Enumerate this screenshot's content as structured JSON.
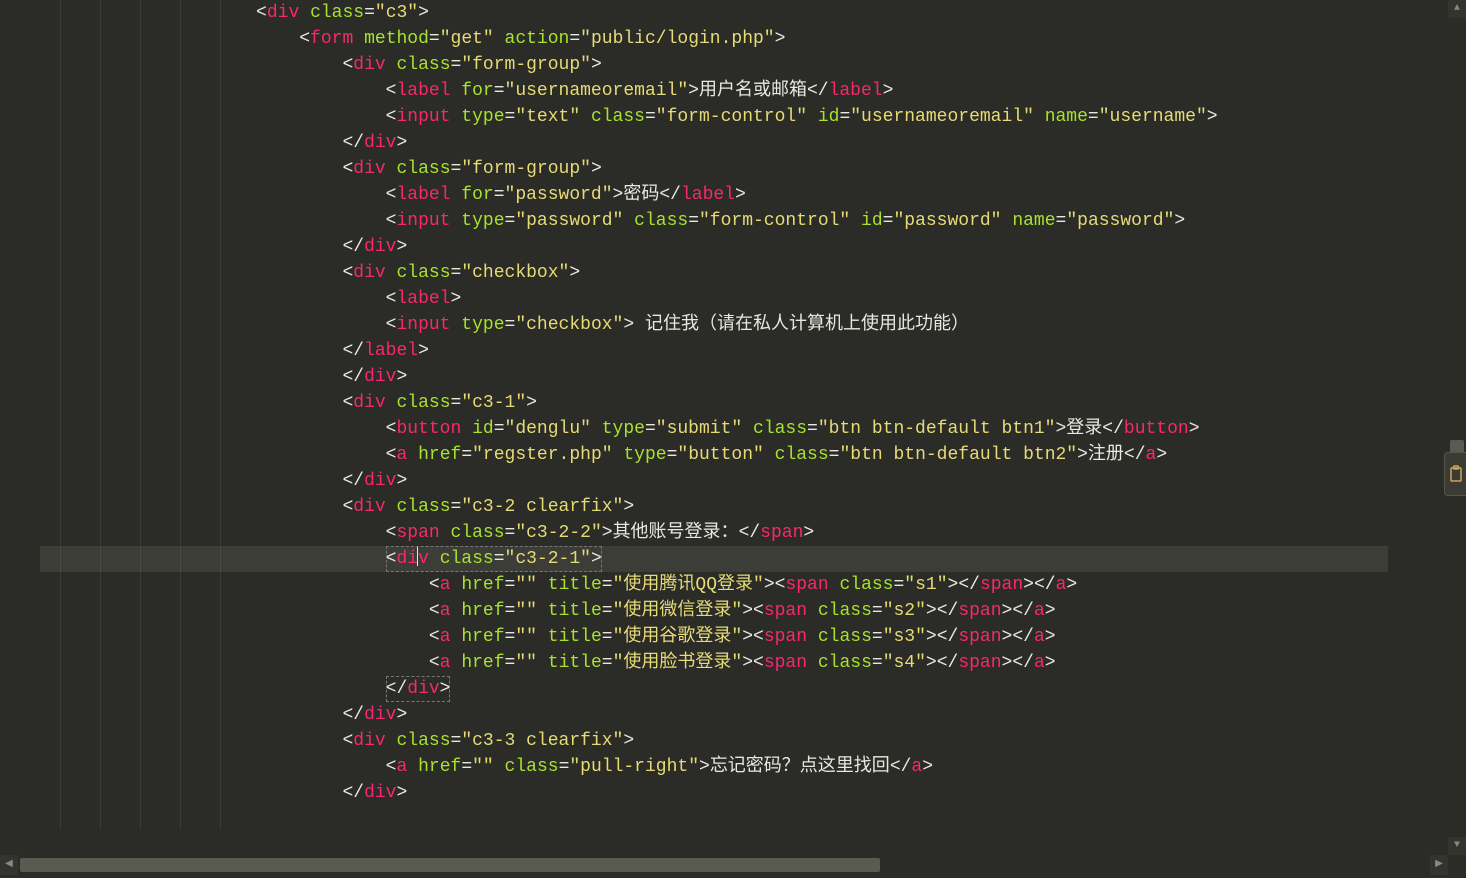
{
  "colors": {
    "bg": "#2b2b27",
    "tag": "#f92672",
    "attr": "#a6e22e",
    "string": "#e6db74",
    "text": "#e8e8e0"
  },
  "highlighted_line_index": 21,
  "lines": [
    {
      "indent": 5,
      "tokens": [
        [
          "p",
          "<"
        ],
        [
          "t",
          "div"
        ],
        [
          "p",
          " "
        ],
        [
          "a",
          "class"
        ],
        [
          "p",
          "="
        ],
        [
          "s",
          "\"c3\""
        ],
        [
          "p",
          ">"
        ]
      ]
    },
    {
      "indent": 6,
      "tokens": [
        [
          "p",
          "<"
        ],
        [
          "t",
          "form"
        ],
        [
          "p",
          " "
        ],
        [
          "a",
          "method"
        ],
        [
          "p",
          "="
        ],
        [
          "s",
          "\"get\""
        ],
        [
          "p",
          " "
        ],
        [
          "a",
          "action"
        ],
        [
          "p",
          "="
        ],
        [
          "s",
          "\"public/login.php\""
        ],
        [
          "p",
          ">"
        ]
      ]
    },
    {
      "indent": 7,
      "tokens": [
        [
          "p",
          "<"
        ],
        [
          "t",
          "div"
        ],
        [
          "p",
          " "
        ],
        [
          "a",
          "class"
        ],
        [
          "p",
          "="
        ],
        [
          "s",
          "\"form-group\""
        ],
        [
          "p",
          ">"
        ]
      ]
    },
    {
      "indent": 8,
      "tokens": [
        [
          "p",
          "<"
        ],
        [
          "t",
          "label"
        ],
        [
          "p",
          " "
        ],
        [
          "a",
          "for"
        ],
        [
          "p",
          "="
        ],
        [
          "s",
          "\"usernameoremail\""
        ],
        [
          "p",
          ">"
        ],
        [
          "tx",
          "用户名或邮箱"
        ],
        [
          "p",
          "</"
        ],
        [
          "t",
          "label"
        ],
        [
          "p",
          ">"
        ]
      ]
    },
    {
      "indent": 8,
      "tokens": [
        [
          "p",
          "<"
        ],
        [
          "t",
          "input"
        ],
        [
          "p",
          " "
        ],
        [
          "a",
          "type"
        ],
        [
          "p",
          "="
        ],
        [
          "s",
          "\"text\""
        ],
        [
          "p",
          " "
        ],
        [
          "a",
          "class"
        ],
        [
          "p",
          "="
        ],
        [
          "s",
          "\"form-control\""
        ],
        [
          "p",
          " "
        ],
        [
          "a",
          "id"
        ],
        [
          "p",
          "="
        ],
        [
          "s",
          "\"usernameoremail\""
        ],
        [
          "p",
          " "
        ],
        [
          "a",
          "name"
        ],
        [
          "p",
          "="
        ],
        [
          "s",
          "\"username\""
        ],
        [
          "p",
          ">"
        ]
      ]
    },
    {
      "indent": 7,
      "tokens": [
        [
          "p",
          "</"
        ],
        [
          "t",
          "div"
        ],
        [
          "p",
          ">"
        ]
      ]
    },
    {
      "indent": 7,
      "tokens": [
        [
          "p",
          "<"
        ],
        [
          "t",
          "div"
        ],
        [
          "p",
          " "
        ],
        [
          "a",
          "class"
        ],
        [
          "p",
          "="
        ],
        [
          "s",
          "\"form-group\""
        ],
        [
          "p",
          ">"
        ]
      ]
    },
    {
      "indent": 8,
      "tokens": [
        [
          "p",
          "<"
        ],
        [
          "t",
          "label"
        ],
        [
          "p",
          " "
        ],
        [
          "a",
          "for"
        ],
        [
          "p",
          "="
        ],
        [
          "s",
          "\"password\""
        ],
        [
          "p",
          ">"
        ],
        [
          "tx",
          "密码"
        ],
        [
          "p",
          "</"
        ],
        [
          "t",
          "label"
        ],
        [
          "p",
          ">"
        ]
      ]
    },
    {
      "indent": 8,
      "tokens": [
        [
          "p",
          "<"
        ],
        [
          "t",
          "input"
        ],
        [
          "p",
          " "
        ],
        [
          "a",
          "type"
        ],
        [
          "p",
          "="
        ],
        [
          "s",
          "\"password\""
        ],
        [
          "p",
          " "
        ],
        [
          "a",
          "class"
        ],
        [
          "p",
          "="
        ],
        [
          "s",
          "\"form-control\""
        ],
        [
          "p",
          " "
        ],
        [
          "a",
          "id"
        ],
        [
          "p",
          "="
        ],
        [
          "s",
          "\"password\""
        ],
        [
          "p",
          " "
        ],
        [
          "a",
          "name"
        ],
        [
          "p",
          "="
        ],
        [
          "s",
          "\"password\""
        ],
        [
          "p",
          ">"
        ]
      ]
    },
    {
      "indent": 7,
      "tokens": [
        [
          "p",
          "</"
        ],
        [
          "t",
          "div"
        ],
        [
          "p",
          ">"
        ]
      ]
    },
    {
      "indent": 7,
      "tokens": [
        [
          "p",
          "<"
        ],
        [
          "t",
          "div"
        ],
        [
          "p",
          " "
        ],
        [
          "a",
          "class"
        ],
        [
          "p",
          "="
        ],
        [
          "s",
          "\"checkbox\""
        ],
        [
          "p",
          ">"
        ]
      ]
    },
    {
      "indent": 8,
      "tokens": [
        [
          "p",
          "<"
        ],
        [
          "t",
          "label"
        ],
        [
          "p",
          ">"
        ]
      ]
    },
    {
      "indent": 8,
      "tokens": [
        [
          "p",
          "<"
        ],
        [
          "t",
          "input"
        ],
        [
          "p",
          " "
        ],
        [
          "a",
          "type"
        ],
        [
          "p",
          "="
        ],
        [
          "s",
          "\"checkbox\""
        ],
        [
          "p",
          ">"
        ],
        [
          "tx",
          " 记住我（请在私人计算机上使用此功能）"
        ]
      ]
    },
    {
      "indent": 7,
      "tokens": [
        [
          "p",
          "</"
        ],
        [
          "t",
          "label"
        ],
        [
          "p",
          ">"
        ]
      ]
    },
    {
      "indent": 7,
      "tokens": [
        [
          "p",
          "</"
        ],
        [
          "t",
          "div"
        ],
        [
          "p",
          ">"
        ]
      ]
    },
    {
      "indent": 7,
      "tokens": [
        [
          "p",
          "<"
        ],
        [
          "t",
          "div"
        ],
        [
          "p",
          " "
        ],
        [
          "a",
          "class"
        ],
        [
          "p",
          "="
        ],
        [
          "s",
          "\"c3-1\""
        ],
        [
          "p",
          ">"
        ]
      ]
    },
    {
      "indent": 8,
      "tokens": [
        [
          "p",
          "<"
        ],
        [
          "t",
          "button"
        ],
        [
          "p",
          " "
        ],
        [
          "a",
          "id"
        ],
        [
          "p",
          "="
        ],
        [
          "s",
          "\"denglu\""
        ],
        [
          "p",
          " "
        ],
        [
          "a",
          "type"
        ],
        [
          "p",
          "="
        ],
        [
          "s",
          "\"submit\""
        ],
        [
          "p",
          " "
        ],
        [
          "a",
          "class"
        ],
        [
          "p",
          "="
        ],
        [
          "s",
          "\"btn btn-default btn1\""
        ],
        [
          "p",
          ">"
        ],
        [
          "tx",
          "登录"
        ],
        [
          "p",
          "</"
        ],
        [
          "t",
          "button"
        ],
        [
          "p",
          ">"
        ]
      ]
    },
    {
      "indent": 8,
      "tokens": [
        [
          "p",
          "<"
        ],
        [
          "t",
          "a"
        ],
        [
          "p",
          " "
        ],
        [
          "a",
          "href"
        ],
        [
          "p",
          "="
        ],
        [
          "s",
          "\"regster.php\""
        ],
        [
          "p",
          " "
        ],
        [
          "a",
          "type"
        ],
        [
          "p",
          "="
        ],
        [
          "s",
          "\"button\""
        ],
        [
          "p",
          " "
        ],
        [
          "a",
          "class"
        ],
        [
          "p",
          "="
        ],
        [
          "s",
          "\"btn btn-default btn2\""
        ],
        [
          "p",
          ">"
        ],
        [
          "tx",
          "注册"
        ],
        [
          "p",
          "</"
        ],
        [
          "t",
          "a"
        ],
        [
          "p",
          ">"
        ]
      ]
    },
    {
      "indent": 7,
      "tokens": [
        [
          "p",
          "</"
        ],
        [
          "t",
          "div"
        ],
        [
          "p",
          ">"
        ]
      ]
    },
    {
      "indent": 7,
      "tokens": [
        [
          "p",
          "<"
        ],
        [
          "t",
          "div"
        ],
        [
          "p",
          " "
        ],
        [
          "a",
          "class"
        ],
        [
          "p",
          "="
        ],
        [
          "s",
          "\"c3-2 clearfix\""
        ],
        [
          "p",
          ">"
        ]
      ]
    },
    {
      "indent": 8,
      "tokens": [
        [
          "p",
          "<"
        ],
        [
          "t",
          "span"
        ],
        [
          "p",
          " "
        ],
        [
          "a",
          "class"
        ],
        [
          "p",
          "="
        ],
        [
          "s",
          "\"c3-2-2\""
        ],
        [
          "p",
          ">"
        ],
        [
          "tx",
          "其他账号登录："
        ],
        [
          "p",
          "</"
        ],
        [
          "t",
          "span"
        ],
        [
          "p",
          ">"
        ]
      ]
    },
    {
      "indent": 8,
      "boxed": true,
      "cursor_after": 3,
      "tokens": [
        [
          "p",
          "<"
        ],
        [
          "t",
          "div"
        ],
        [
          "p",
          " "
        ],
        [
          "a",
          "class"
        ],
        [
          "p",
          "="
        ],
        [
          "s",
          "\"c3-2-1\""
        ],
        [
          "p",
          ">"
        ]
      ]
    },
    {
      "indent": 9,
      "tokens": [
        [
          "p",
          "<"
        ],
        [
          "t",
          "a"
        ],
        [
          "p",
          " "
        ],
        [
          "a",
          "href"
        ],
        [
          "p",
          "="
        ],
        [
          "s",
          "\"\""
        ],
        [
          "p",
          " "
        ],
        [
          "a",
          "title"
        ],
        [
          "p",
          "="
        ],
        [
          "s",
          "\"使用腾讯QQ登录\""
        ],
        [
          "p",
          ">"
        ],
        [
          "p",
          "<"
        ],
        [
          "t",
          "span"
        ],
        [
          "p",
          " "
        ],
        [
          "a",
          "class"
        ],
        [
          "p",
          "="
        ],
        [
          "s",
          "\"s1\""
        ],
        [
          "p",
          ">"
        ],
        [
          "p",
          "</"
        ],
        [
          "t",
          "span"
        ],
        [
          "p",
          ">"
        ],
        [
          "p",
          "</"
        ],
        [
          "t",
          "a"
        ],
        [
          "p",
          ">"
        ]
      ]
    },
    {
      "indent": 9,
      "tokens": [
        [
          "p",
          "<"
        ],
        [
          "t",
          "a"
        ],
        [
          "p",
          " "
        ],
        [
          "a",
          "href"
        ],
        [
          "p",
          "="
        ],
        [
          "s",
          "\"\""
        ],
        [
          "p",
          " "
        ],
        [
          "a",
          "title"
        ],
        [
          "p",
          "="
        ],
        [
          "s",
          "\"使用微信登录\""
        ],
        [
          "p",
          ">"
        ],
        [
          "p",
          "<"
        ],
        [
          "t",
          "span"
        ],
        [
          "p",
          " "
        ],
        [
          "a",
          "class"
        ],
        [
          "p",
          "="
        ],
        [
          "s",
          "\"s2\""
        ],
        [
          "p",
          ">"
        ],
        [
          "p",
          "</"
        ],
        [
          "t",
          "span"
        ],
        [
          "p",
          ">"
        ],
        [
          "p",
          "</"
        ],
        [
          "t",
          "a"
        ],
        [
          "p",
          ">"
        ]
      ]
    },
    {
      "indent": 9,
      "tokens": [
        [
          "p",
          "<"
        ],
        [
          "t",
          "a"
        ],
        [
          "p",
          " "
        ],
        [
          "a",
          "href"
        ],
        [
          "p",
          "="
        ],
        [
          "s",
          "\"\""
        ],
        [
          "p",
          " "
        ],
        [
          "a",
          "title"
        ],
        [
          "p",
          "="
        ],
        [
          "s",
          "\"使用谷歌登录\""
        ],
        [
          "p",
          ">"
        ],
        [
          "p",
          "<"
        ],
        [
          "t",
          "span"
        ],
        [
          "p",
          " "
        ],
        [
          "a",
          "class"
        ],
        [
          "p",
          "="
        ],
        [
          "s",
          "\"s3\""
        ],
        [
          "p",
          ">"
        ],
        [
          "p",
          "</"
        ],
        [
          "t",
          "span"
        ],
        [
          "p",
          ">"
        ],
        [
          "p",
          "</"
        ],
        [
          "t",
          "a"
        ],
        [
          "p",
          ">"
        ]
      ]
    },
    {
      "indent": 9,
      "tokens": [
        [
          "p",
          "<"
        ],
        [
          "t",
          "a"
        ],
        [
          "p",
          " "
        ],
        [
          "a",
          "href"
        ],
        [
          "p",
          "="
        ],
        [
          "s",
          "\"\""
        ],
        [
          "p",
          " "
        ],
        [
          "a",
          "title"
        ],
        [
          "p",
          "="
        ],
        [
          "s",
          "\"使用脸书登录\""
        ],
        [
          "p",
          ">"
        ],
        [
          "p",
          "<"
        ],
        [
          "t",
          "span"
        ],
        [
          "p",
          " "
        ],
        [
          "a",
          "class"
        ],
        [
          "p",
          "="
        ],
        [
          "s",
          "\"s4\""
        ],
        [
          "p",
          ">"
        ],
        [
          "p",
          "</"
        ],
        [
          "t",
          "span"
        ],
        [
          "p",
          ">"
        ],
        [
          "p",
          "</"
        ],
        [
          "t",
          "a"
        ],
        [
          "p",
          ">"
        ]
      ]
    },
    {
      "indent": 8,
      "boxed": true,
      "tokens": [
        [
          "p",
          "</"
        ],
        [
          "t",
          "div"
        ],
        [
          "p",
          ">"
        ]
      ]
    },
    {
      "indent": 7,
      "tokens": [
        [
          "p",
          "</"
        ],
        [
          "t",
          "div"
        ],
        [
          "p",
          ">"
        ]
      ]
    },
    {
      "indent": 7,
      "tokens": [
        [
          "p",
          "<"
        ],
        [
          "t",
          "div"
        ],
        [
          "p",
          " "
        ],
        [
          "a",
          "class"
        ],
        [
          "p",
          "="
        ],
        [
          "s",
          "\"c3-3 clearfix\""
        ],
        [
          "p",
          ">"
        ]
      ]
    },
    {
      "indent": 8,
      "tokens": [
        [
          "p",
          "<"
        ],
        [
          "t",
          "a"
        ],
        [
          "p",
          " "
        ],
        [
          "a",
          "href"
        ],
        [
          "p",
          "="
        ],
        [
          "s",
          "\"\""
        ],
        [
          "p",
          " "
        ],
        [
          "a",
          "class"
        ],
        [
          "p",
          "="
        ],
        [
          "s",
          "\"pull-right\""
        ],
        [
          "p",
          ">"
        ],
        [
          "tx",
          "忘记密码？点这里找回"
        ],
        [
          "p",
          "</"
        ],
        [
          "t",
          "a"
        ],
        [
          "p",
          ">"
        ]
      ]
    },
    {
      "indent": 7,
      "tokens": [
        [
          "p",
          "</"
        ],
        [
          "t",
          "div"
        ],
        [
          "p",
          ">"
        ]
      ]
    }
  ]
}
